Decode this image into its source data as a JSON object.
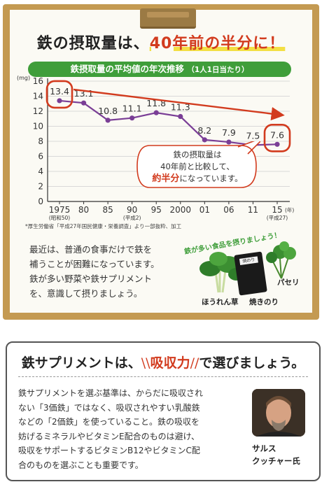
{
  "headline": {
    "prefix": "鉄の摂取量は、",
    "highlight": "40年前の半分に！"
  },
  "banner": {
    "text": "鉄摂取量の平均値の年次推移",
    "sub": "（1人1日当たり）"
  },
  "chart_data": {
    "type": "line",
    "ylabel": "(mg)",
    "ylim": [
      0,
      16
    ],
    "yticks": [
      0,
      2,
      4,
      6,
      8,
      10,
      12,
      14,
      16
    ],
    "x": [
      "1975",
      "80",
      "85",
      "90",
      "95",
      "2000",
      "01",
      "06",
      "11",
      "15"
    ],
    "x_sub": [
      "(昭和50)",
      "",
      "",
      "(平成2)",
      "",
      "",
      "",
      "",
      "",
      "(平成27)"
    ],
    "x_unit": "(年)",
    "values": [
      13.4,
      13.1,
      10.8,
      11.1,
      11.8,
      11.3,
      8.2,
      7.9,
      7.5,
      7.6
    ],
    "value_labels": [
      "13.4",
      "13.1",
      "10.8",
      "11.1",
      "11.8",
      "11.3",
      "8.2",
      "7.9",
      "7.5",
      "7.6"
    ],
    "line_color": "#7a3e96",
    "circled_points": [
      0,
      9
    ],
    "grid": true
  },
  "callout": {
    "line1": "鉄の摂取量は",
    "line2": "40年前と比較して、",
    "emph": "約半分",
    "line3_rest": "になっています。"
  },
  "source_note": "*厚生労働省「平成27年国民健康・栄養調査」より一部抜粋、加工",
  "body_lines": [
    "最近は、普通の食事だけで鉄を",
    "補うことが困難になっています。",
    "鉄が多い野菜や鉄サプリメント",
    "を、意識して摂りましょう。"
  ],
  "food_caption": "鉄が多い食品を摂りましょう！",
  "foods": [
    "ほうれん草",
    "焼きのり",
    "パセリ"
  ],
  "nori_label": "焼のり",
  "panel_title": {
    "a": "鉄サプリメントは、",
    "left_slash": "\\\\",
    "red": "吸収力",
    "right_slash": "//",
    "b": "で選びましょう。"
  },
  "panel_lines": [
    "鉄サプリメントを選ぶ基準は、からだに吸収され",
    "ない「3価鉄」ではなく、吸収されやすい乳酸鉄",
    "などの「2価鉄」を使っていること。鉄の吸収を",
    "妨げるミネラルやビタミンE配合のものは避け、",
    "吸収をサポートするビタミンB12やビタミンC配",
    "合のものを選ぶことも重要です。"
  ],
  "person": {
    "line1": "サルス",
    "line2": "クッチャー氏"
  },
  "colors": {
    "accent_red": "#d23b1e",
    "green": "#3f9e3a",
    "purple": "#7a3e96",
    "board": "#c49a52"
  }
}
